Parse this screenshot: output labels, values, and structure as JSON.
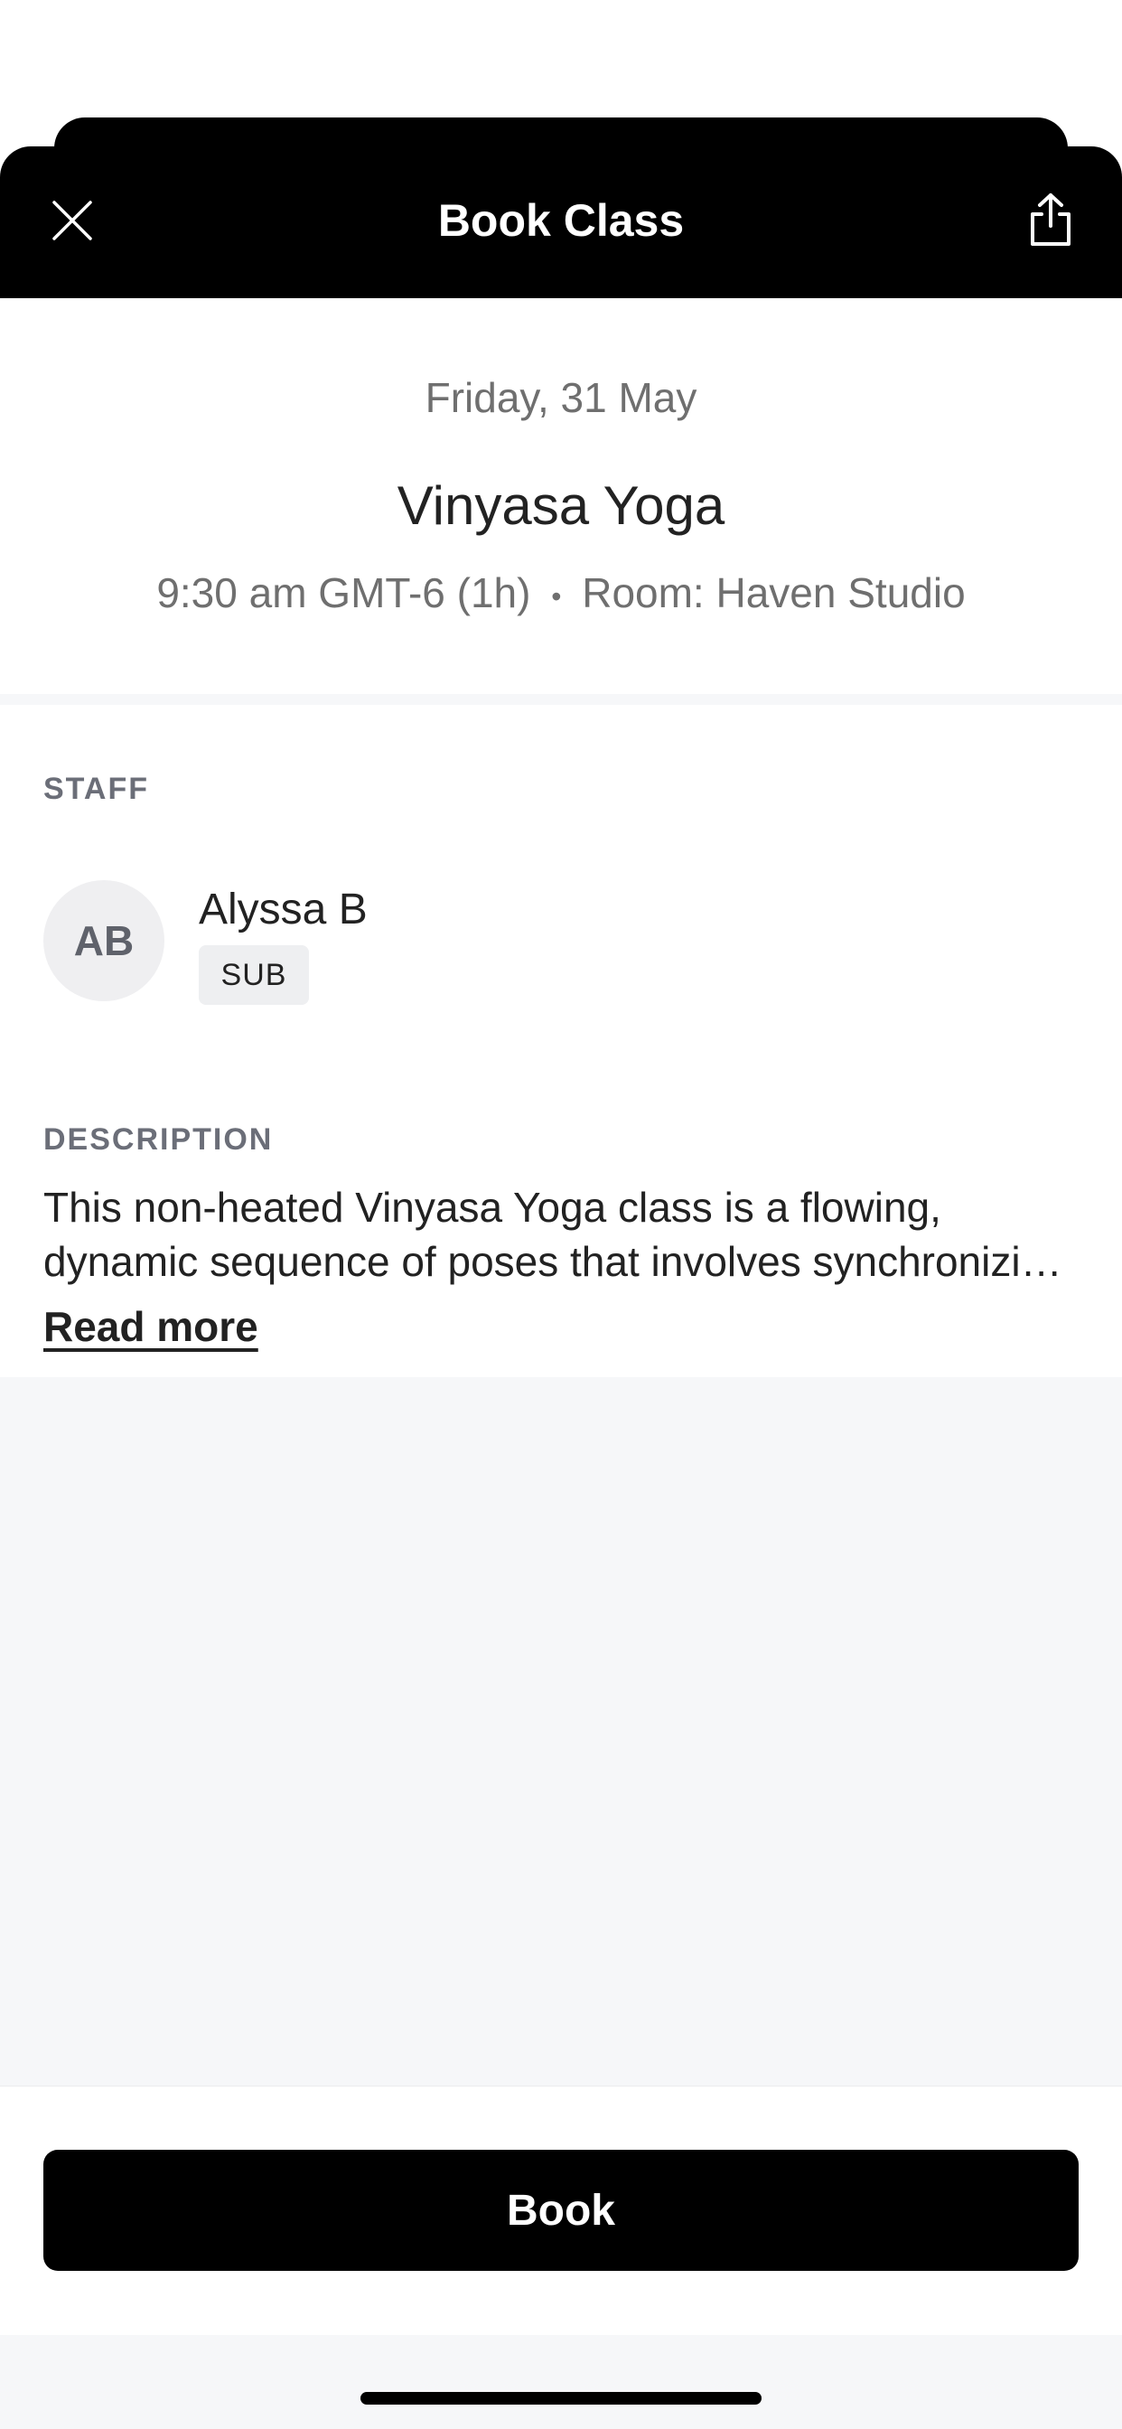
{
  "header": {
    "title": "Book Class",
    "close_icon": "close-icon",
    "share_icon": "share-icon"
  },
  "class_info": {
    "date": "Friday, 31 May",
    "name": "Vinyasa Yoga",
    "time": "9:30 am GMT-6 (1h)",
    "separator": "•",
    "room": "Room: Haven Studio"
  },
  "staff": {
    "section_label": "STAFF",
    "initials": "AB",
    "name": "Alyssa B",
    "badge": "SUB"
  },
  "description": {
    "section_label": "DESCRIPTION",
    "line1": "This non-heated Vinyasa Yoga class is a flowing,",
    "line2": "dynamic sequence of poses that involves synchronizing breath with movement",
    "read_more": "Read more"
  },
  "footer": {
    "book_label": "Book"
  },
  "colors": {
    "header_bg": "#000000",
    "page_bg": "#ffffff",
    "muted_bg": "#f6f7f9",
    "button_bg": "#000000"
  }
}
